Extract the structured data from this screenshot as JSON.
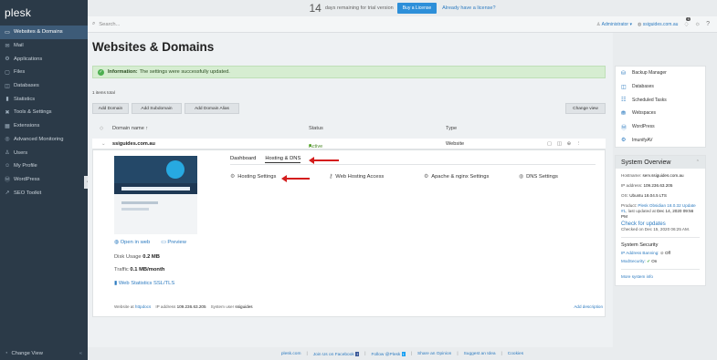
{
  "app": {
    "logo": "plesk"
  },
  "sidebar": {
    "items": [
      {
        "label": "Websites & Domains",
        "icon": "monitor-icon",
        "glyph": "▭",
        "active": true
      },
      {
        "label": "Mail",
        "icon": "mail-icon",
        "glyph": "✉",
        "active": false
      },
      {
        "label": "Applications",
        "icon": "applications-icon",
        "glyph": "⚙",
        "active": false
      },
      {
        "label": "Files",
        "icon": "folder-icon",
        "glyph": "▢",
        "active": false
      },
      {
        "label": "Databases",
        "icon": "database-icon",
        "glyph": "◫",
        "active": false
      },
      {
        "label": "Statistics",
        "icon": "statistics-icon",
        "glyph": "▮",
        "active": false
      },
      {
        "label": "Tools & Settings",
        "icon": "tools-icon",
        "glyph": "✖",
        "active": false
      },
      {
        "label": "Extensions",
        "icon": "extensions-icon",
        "glyph": "▦",
        "active": false
      },
      {
        "label": "Advanced Monitoring",
        "icon": "monitoring-icon",
        "glyph": "◎",
        "active": false
      },
      {
        "label": "Users",
        "icon": "users-icon",
        "glyph": "♙",
        "active": false
      },
      {
        "label": "My Profile",
        "icon": "profile-icon",
        "glyph": "☺",
        "active": false
      },
      {
        "label": "WordPress",
        "icon": "wordpress-icon",
        "glyph": "Ⓦ",
        "active": false
      },
      {
        "label": "SEO Toolkit",
        "icon": "seo-icon",
        "glyph": "↗",
        "active": false
      }
    ],
    "footer": {
      "label": "Change View",
      "chevron": "«"
    },
    "collapse_glyph": "‹"
  },
  "trial": {
    "days": "14",
    "text": "days remaining for trial version",
    "buy_label": "Buy a License",
    "link_label": "Already have a license?"
  },
  "topbar": {
    "search_placeholder": "Search...",
    "user": "Administrator ▾",
    "site": "ssiguides.com.au",
    "notifications": "1"
  },
  "main": {
    "title": "Websites & Domains",
    "alert": {
      "strong": "Information:",
      "text": "The settings were successfully updated."
    },
    "items_total": "1 items total",
    "buttons": {
      "add_domain": "Add Domain",
      "add_subdomain": "Add Subdomain",
      "add_alias": "Add Domain Alias",
      "change_view": "Change view"
    },
    "table": {
      "col_domain": "Domain name ↑",
      "col_status": "Status",
      "col_type": "Type",
      "row": {
        "domain": "ssiguides.com.au",
        "status": "Active ▾",
        "type": "Website",
        "icons": "▢ ◫ ⊕ ⋮"
      }
    },
    "panel": {
      "tabs": {
        "dashboard": "Dashboard",
        "hosting_dns": "Hosting & DNS"
      },
      "tools": {
        "hosting_settings": "Hosting Settings",
        "web_hosting_access": "Web Hosting Access",
        "apache_nginx": "Apache & nginx Settings",
        "dns_settings": "DNS Settings"
      },
      "open_in_web": "Open in web",
      "preview": "Preview",
      "disk_usage_label": "Disk Usage",
      "disk_usage_value": "0.2 MB",
      "traffic_label": "Traffic",
      "traffic_value": "0.1 MB/month",
      "web_stats": "Web Statistics SSL/TLS",
      "footer": {
        "website_at": "Website at",
        "httpdocs": "httpdocs",
        "ip_label": "IP address",
        "ip_value": "109.236.63.205",
        "sys_user_label": "System user",
        "sys_user_value": "ssiguides",
        "add_description": "Add description"
      }
    }
  },
  "right": {
    "links": [
      {
        "label": "Backup Manager",
        "icon": "backup-icon",
        "glyph": "⛁"
      },
      {
        "label": "Databases",
        "icon": "database-icon",
        "glyph": "◫"
      },
      {
        "label": "Scheduled Tasks",
        "icon": "tasks-icon",
        "glyph": "☷"
      },
      {
        "label": "Webspaces",
        "icon": "webspaces-icon",
        "glyph": "⛃"
      },
      {
        "label": "WordPress",
        "icon": "wordpress-icon",
        "glyph": "Ⓦ"
      },
      {
        "label": "ImunifyAV",
        "icon": "imunify-icon",
        "glyph": "⚙"
      }
    ],
    "overview": {
      "title": "System Overview",
      "hostname_label": "Hostname:",
      "hostname": "serv.ssiguides.com.au",
      "ip_label": "IP address:",
      "ip": "109.236.63.205",
      "os_label": "OS:",
      "os": "Ubuntu 18.04.5 LTS",
      "product_label": "Product:",
      "product": "Plesk Obsidian 18.0.32 Update #1",
      "updated_label": ", last updated at",
      "updated": "Dec 14, 2020 09:56 PM",
      "check_updates": "Check for updates",
      "checked_on": "Checked on Dec 15, 2020 06:25 AM.",
      "security_title": "System Security",
      "ip_banning": "IP Address Banning:",
      "ip_banning_value": "Off",
      "modsecurity": "ModSecurity:",
      "modsecurity_value": "On",
      "more_info": "More system info"
    }
  },
  "footer": {
    "links": [
      "plesk.com",
      "Join Us on Facebook",
      "Follow @Plesk",
      "Share an Opinion",
      "Suggest an Idea",
      "Cookies"
    ],
    "sep": "|",
    "fb": "f",
    "tw": "t"
  },
  "colors": {
    "sidebar_bg": "#2b3a48",
    "sidebar_active": "#3d5b78",
    "accent": "#2d8fd9",
    "alert_bg": "#d6edd1",
    "annotation_arrow": "#d41c1c"
  }
}
